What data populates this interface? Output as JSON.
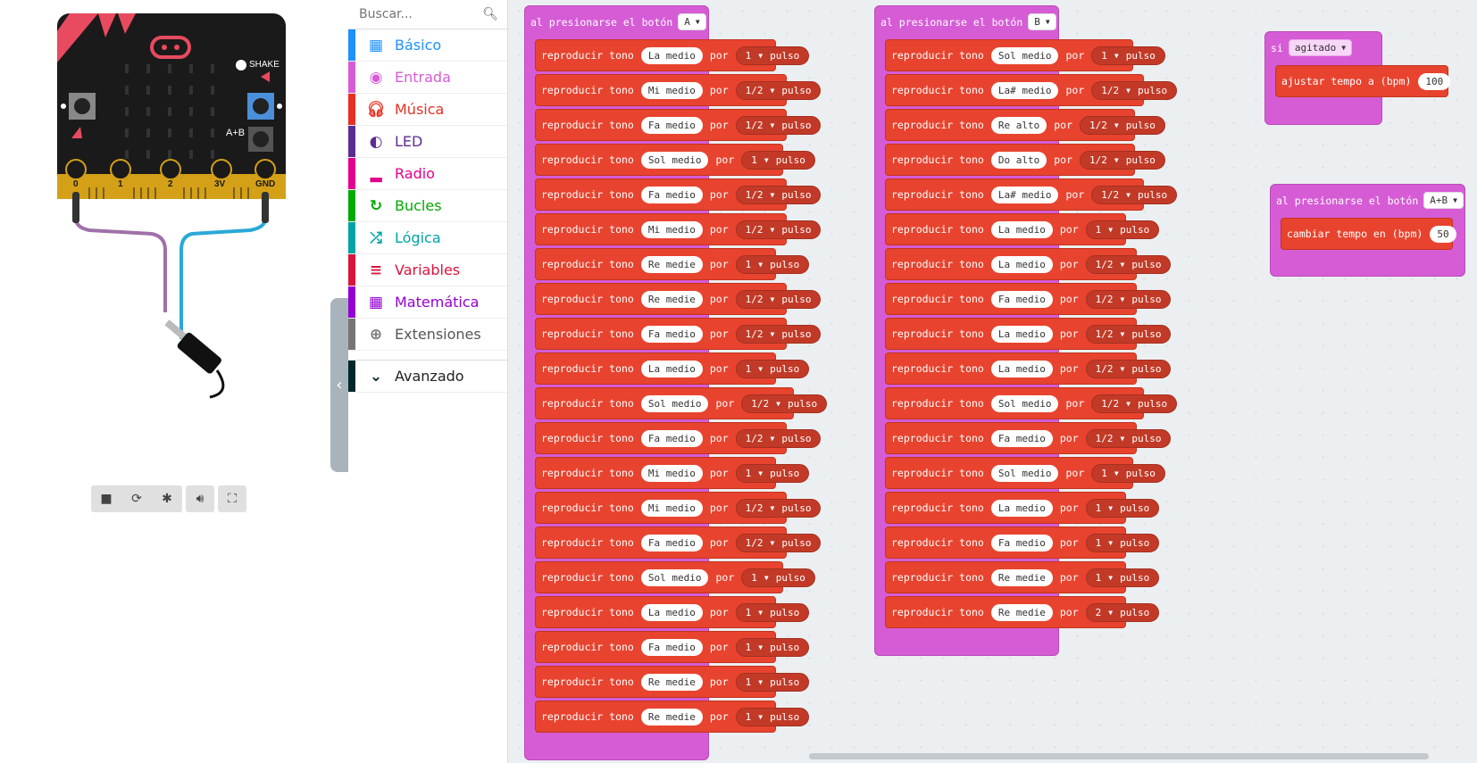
{
  "simulator": {
    "shake_label": "SHAKE",
    "ab_label": "A+B",
    "pin_labels": [
      "0",
      "1",
      "2",
      "3V",
      "GND"
    ],
    "button_a_label": "A",
    "button_b_label": "B",
    "controls": [
      "stop-icon",
      "restart-icon",
      "debug-icon",
      "sound-icon",
      "fullscreen-icon"
    ]
  },
  "toolbox": {
    "search_placeholder": "Buscar...",
    "categories": [
      {
        "label": "Básico",
        "color": "#1e90ff",
        "icon": "grid-icon"
      },
      {
        "label": "Entrada",
        "color": "#d65cd6",
        "icon": "target-icon"
      },
      {
        "label": "Música",
        "color": "#e63022",
        "icon": "headphones-icon"
      },
      {
        "label": "LED",
        "color": "#5c2d91",
        "icon": "toggle-icon"
      },
      {
        "label": "Radio",
        "color": "#e3008c",
        "icon": "signal-icon"
      },
      {
        "label": "Bucles",
        "color": "#00aa00",
        "icon": "loop-icon"
      },
      {
        "label": "Lógica",
        "color": "#00a4a6",
        "icon": "shuffle-icon"
      },
      {
        "label": "Variables",
        "color": "#dc143c",
        "icon": "lines-icon"
      },
      {
        "label": "Matemática",
        "color": "#9400d3",
        "icon": "calculator-icon"
      },
      {
        "label": "Extensiones",
        "color": "#757575",
        "icon": "plus-icon"
      },
      {
        "label": "Avanzado",
        "color": "#00272b",
        "icon": "chevron-down-icon"
      }
    ]
  },
  "workspace": {
    "play_text": "reproducir tono",
    "for_text": "por",
    "pulse_text": "pulso",
    "button_a_handler": {
      "label": "al presionarse el botón",
      "button": "A",
      "tones": [
        {
          "note": "La medio",
          "beat": "1"
        },
        {
          "note": "Mi medio",
          "beat": "1/2"
        },
        {
          "note": "Fa medio",
          "beat": "1/2"
        },
        {
          "note": "Sol medio",
          "beat": "1"
        },
        {
          "note": "Fa medio",
          "beat": "1/2"
        },
        {
          "note": "Mi medio",
          "beat": "1/2"
        },
        {
          "note": "Re medie",
          "beat": "1"
        },
        {
          "note": "Re medie",
          "beat": "1/2"
        },
        {
          "note": "Fa medio",
          "beat": "1/2"
        },
        {
          "note": "La medio",
          "beat": "1"
        },
        {
          "note": "Sol medio",
          "beat": "1/2"
        },
        {
          "note": "Fa medio",
          "beat": "1/2"
        },
        {
          "note": "Mi medio",
          "beat": "1"
        },
        {
          "note": "Mi medio",
          "beat": "1/2"
        },
        {
          "note": "Fa medio",
          "beat": "1/2"
        },
        {
          "note": "Sol medio",
          "beat": "1"
        },
        {
          "note": "La medio",
          "beat": "1"
        },
        {
          "note": "Fa medio",
          "beat": "1"
        },
        {
          "note": "Re medie",
          "beat": "1"
        },
        {
          "note": "Re medie",
          "beat": "1"
        }
      ]
    },
    "button_b_handler": {
      "label": "al presionarse el botón",
      "button": "B",
      "tones": [
        {
          "note": "Sol medio",
          "beat": "1"
        },
        {
          "note": "La# medio",
          "beat": "1/2"
        },
        {
          "note": "Re alto",
          "beat": "1/2"
        },
        {
          "note": "Do alto",
          "beat": "1/2"
        },
        {
          "note": "La# medio",
          "beat": "1/2"
        },
        {
          "note": "La medio",
          "beat": "1"
        },
        {
          "note": "La medio",
          "beat": "1/2"
        },
        {
          "note": "Fa medio",
          "beat": "1/2"
        },
        {
          "note": "La medio",
          "beat": "1/2"
        },
        {
          "note": "La medio",
          "beat": "1/2"
        },
        {
          "note": "Sol medio",
          "beat": "1/2"
        },
        {
          "note": "Fa medio",
          "beat": "1/2"
        },
        {
          "note": "Sol medio",
          "beat": "1"
        },
        {
          "note": "La medio",
          "beat": "1"
        },
        {
          "note": "Fa medio",
          "beat": "1"
        },
        {
          "note": "Re medie",
          "beat": "1"
        },
        {
          "note": "Re medie",
          "beat": "2"
        }
      ]
    },
    "gesture_handler": {
      "label": "si",
      "gesture": "agitado",
      "action": "ajustar tempo a (bpm)",
      "value": "100"
    },
    "button_ab_handler": {
      "label": "al presionarse el botón",
      "button": "A+B",
      "action": "cambiar tempo en (bpm)",
      "value": "50"
    }
  }
}
